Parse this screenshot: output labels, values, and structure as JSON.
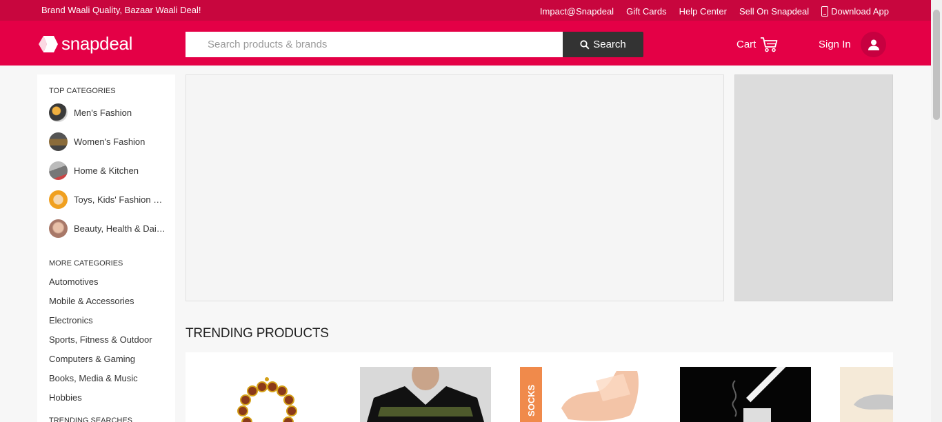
{
  "topbar": {
    "tagline": "Brand Waali Quality, Bazaar Waali Deal!",
    "links": [
      "Impact@Snapdeal",
      "Gift Cards",
      "Help Center",
      "Sell On Snapdeal",
      "Download App"
    ]
  },
  "header": {
    "logo_text": "snapdeal",
    "search_placeholder": "Search products & brands",
    "search_button": "Search",
    "cart_label": "Cart",
    "signin_label": "Sign In"
  },
  "sidebar": {
    "top_heading": "TOP CATEGORIES",
    "top_categories": [
      "Men's Fashion",
      "Women's Fashion",
      "Home & Kitchen",
      "Toys, Kids' Fashion & more",
      "Beauty, Health & Daily Needs"
    ],
    "more_heading": "MORE CATEGORIES",
    "more_categories": [
      "Automotives",
      "Mobile & Accessories",
      "Electronics",
      "Sports, Fitness & Outdoor",
      "Computers & Gaming",
      "Books, Media & Music",
      "Hobbies"
    ],
    "trending_heading": "TRENDING SEARCHES"
  },
  "trending": {
    "title": "TRENDING PRODUCTS"
  },
  "colors": {
    "topbar": "#c8063e",
    "header": "#e40046",
    "search_button": "#333333"
  }
}
